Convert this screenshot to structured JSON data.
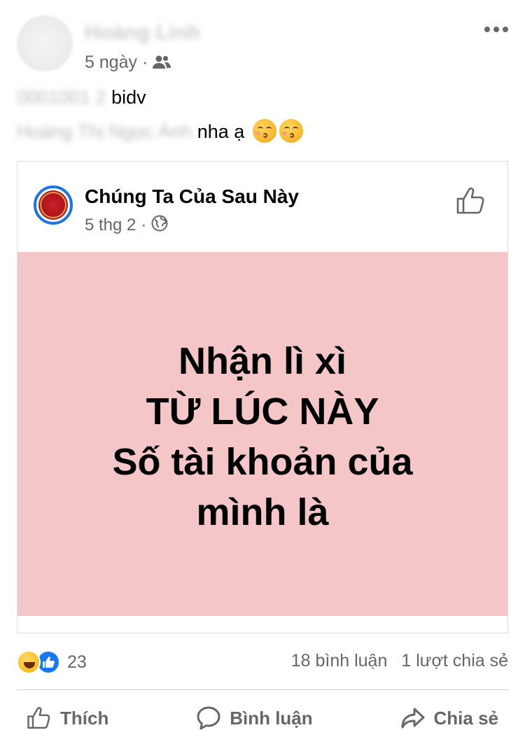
{
  "post": {
    "author": "Hoàng Linh",
    "time": "5 ngày",
    "audience_icon": "friends-icon",
    "more_icon": "more-options-icon",
    "caption_line1_hidden": "0001001 2",
    "caption_line1_visible": "bidv",
    "caption_line2_hidden": "Hoàng Thị Ngọc Ánh",
    "caption_line2_visible": "nha ạ",
    "emoji": "kissing-face-icon"
  },
  "shared": {
    "page_name": "Chúng Ta Của Sau Này",
    "time": "5 thg 2",
    "audience_icon": "globe-icon",
    "like_page_icon": "thumbs-up-icon",
    "image_text": [
      "Nhận lì xì",
      "TỪ LÚC NÀY",
      "Số tài khoản của",
      "mình là"
    ],
    "image_bg": "#f5c6c8"
  },
  "reactions": {
    "icons": [
      "haha-icon",
      "like-icon"
    ],
    "count": "23",
    "comments": "18 bình luận",
    "shares": "1 lượt chia sẻ"
  },
  "actions": {
    "like": "Thích",
    "comment": "Bình luận",
    "share": "Chia sẻ"
  },
  "colors": {
    "accent": "#1877f2",
    "secondary_text": "#65676b",
    "divider": "#ced0d4"
  }
}
